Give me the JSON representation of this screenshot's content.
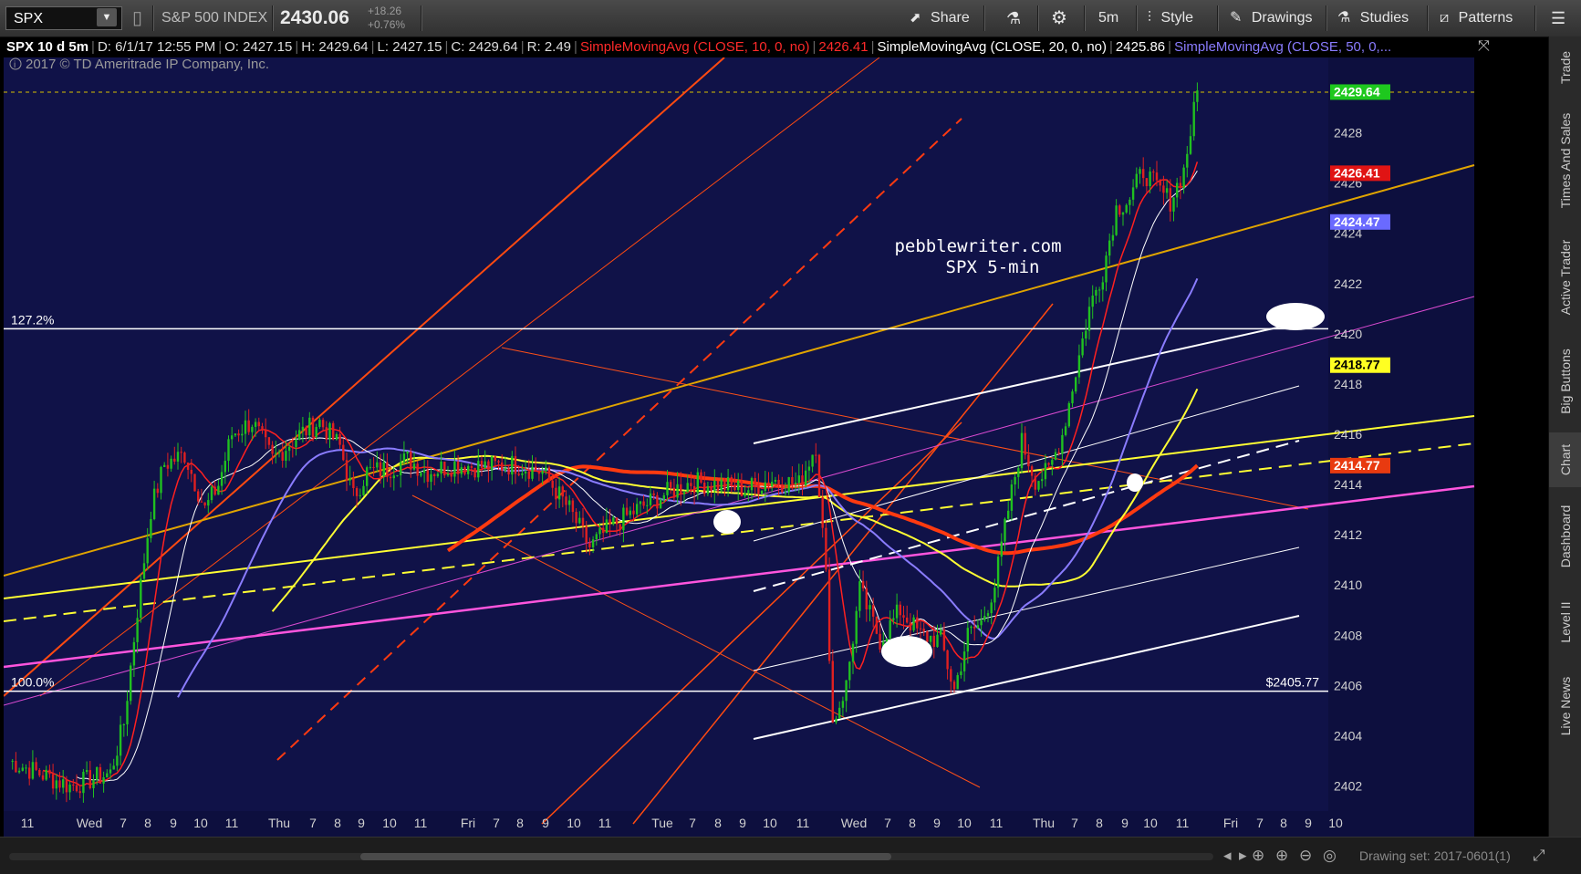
{
  "toolbar": {
    "symbol": "SPX",
    "index_name": "S&P 500 INDEX",
    "last_price": "2430.06",
    "change": "+18.26",
    "change_pct": "+0.76%",
    "share": "Share",
    "interval": "5m",
    "style": "Style",
    "drawings": "Drawings",
    "studies": "Studies",
    "patterns": "Patterns"
  },
  "infobar": {
    "title": "SPX 10 d 5m",
    "date": "D: 6/1/17 12:55 PM",
    "open": "O: 2427.15",
    "high": "H: 2429.64",
    "low": "L: 2427.15",
    "close": "C: 2429.64",
    "range": "R: 2.49",
    "sma10_label": "SimpleMovingAvg (CLOSE, 10, 0, no)",
    "sma10_value": "2426.41",
    "sma20_label": "SimpleMovingAvg (CLOSE, 20, 0, no)",
    "sma20_value": "2425.86",
    "sma50_label": "SimpleMovingAvg (CLOSE, 50, 0,..."
  },
  "colors": {
    "background": "#101248",
    "sma10": "#ff3030",
    "sma20": "#ffffff",
    "sma50": "#8a7cff",
    "yellow": "#ffff33",
    "red_ma": "#ff3a10",
    "magenta": "#ff55dd",
    "gold": "#e0a400"
  },
  "chart_data": {
    "type": "candlestick",
    "copyright": "2017 © TD Ameritrade IP Company, Inc.",
    "watermark_line1": "pebblewriter.com",
    "watermark_line2": "SPX 5-min",
    "ylim": [
      2401,
      2431
    ],
    "y_ticks": [
      2402,
      2404,
      2406,
      2408,
      2410,
      2412,
      2414,
      2416,
      2418,
      2420,
      2422,
      2424,
      2426,
      2428
    ],
    "x_ticks": [
      "11",
      "Wed",
      "7",
      "8",
      "9",
      "10",
      "11",
      "Thu",
      "7",
      "8",
      "9",
      "10",
      "11",
      "Fri",
      "7",
      "8",
      "9",
      "10",
      "11",
      "Tue",
      "7",
      "8",
      "9",
      "10",
      "11",
      "Wed",
      "7",
      "8",
      "9",
      "10",
      "11",
      "Thu",
      "7",
      "8",
      "9",
      "10",
      "11",
      "Fri",
      "7",
      "8",
      "9",
      "10"
    ],
    "levels": [
      {
        "label_left": "127.2%",
        "label_right": "$2420.2",
        "value": 2420.2
      },
      {
        "label_left": "100.0%",
        "label_right": "$2405.77",
        "value": 2405.77
      }
    ],
    "price_badges": [
      {
        "value": "2429.64",
        "color": "#1ec81e"
      },
      {
        "value": "2426.41",
        "color": "#e01414"
      },
      {
        "value": "2424.47",
        "color": "#6a6aff"
      },
      {
        "value": "2418.77",
        "color": "#ffff22"
      },
      {
        "value": "2414.77",
        "color": "#e83a10"
      }
    ],
    "close_path": [
      [
        0,
        2403
      ],
      [
        18,
        2402
      ],
      [
        30,
        2402.5
      ],
      [
        34,
        2404.5
      ],
      [
        38,
        2409
      ],
      [
        42,
        2413
      ],
      [
        46,
        2414.8
      ],
      [
        52,
        2415.2
      ],
      [
        58,
        2413
      ],
      [
        62,
        2414
      ],
      [
        66,
        2416
      ],
      [
        72,
        2416.5
      ],
      [
        78,
        2415
      ],
      [
        86,
        2416
      ],
      [
        92,
        2416.5
      ],
      [
        98,
        2415.5
      ],
      [
        102,
        2413.5
      ],
      [
        106,
        2414.5
      ],
      [
        112,
        2414.6
      ],
      [
        118,
        2415
      ],
      [
        124,
        2414.5
      ],
      [
        132,
        2414.8
      ],
      [
        140,
        2414.7
      ],
      [
        150,
        2414.8
      ],
      [
        158,
        2414.5
      ],
      [
        166,
        2413
      ],
      [
        172,
        2411.5
      ],
      [
        178,
        2412.3
      ],
      [
        186,
        2413
      ],
      [
        194,
        2413.6
      ],
      [
        202,
        2414.1
      ],
      [
        210,
        2414
      ],
      [
        218,
        2413.8
      ],
      [
        226,
        2414.2
      ],
      [
        234,
        2414
      ],
      [
        239,
        2415.6
      ],
      [
        242,
        2410.3
      ],
      [
        244,
        2404.5
      ],
      [
        248,
        2406
      ],
      [
        252,
        2409.8
      ],
      [
        258,
        2407.8
      ],
      [
        264,
        2409
      ],
      [
        270,
        2408
      ],
      [
        276,
        2407.8
      ],
      [
        280,
        2405.8
      ],
      [
        284,
        2408
      ],
      [
        288,
        2408.5
      ],
      [
        292,
        2410
      ],
      [
        296,
        2413
      ],
      [
        300,
        2415.7
      ],
      [
        304,
        2414.2
      ],
      [
        308,
        2414.5
      ],
      [
        312,
        2416
      ],
      [
        316,
        2418.5
      ],
      [
        320,
        2421
      ],
      [
        324,
        2422.5
      ],
      [
        328,
        2425
      ],
      [
        332,
        2425.4
      ],
      [
        336,
        2426.5
      ],
      [
        340,
        2425.8
      ],
      [
        344,
        2425.3
      ],
      [
        348,
        2426.5
      ],
      [
        352,
        2429.6
      ]
    ]
  },
  "bottom": {
    "drawing_set": "Drawing set: 2017-0601(1)"
  },
  "side_tabs": [
    "Trade",
    "Times And Sales",
    "Active Trader",
    "Big Buttons",
    "Chart",
    "Dashboard",
    "Level II",
    "Live News"
  ]
}
